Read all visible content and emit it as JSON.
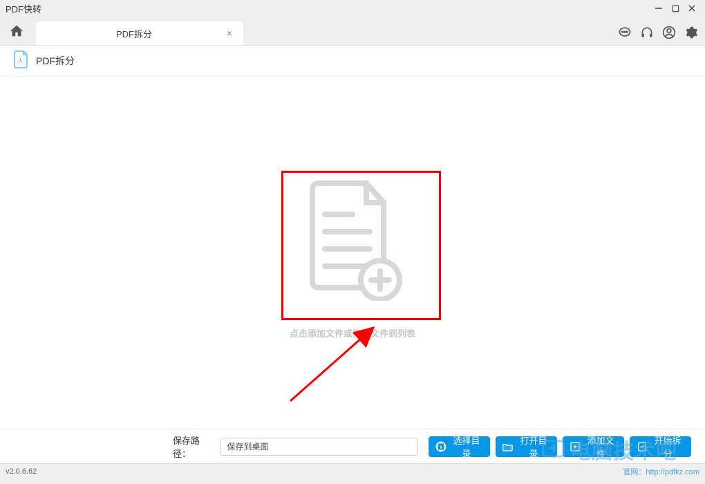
{
  "titlebar": {
    "title": "PDF快转"
  },
  "tab": {
    "label": "PDF拆分"
  },
  "content_header": {
    "label": "PDF拆分"
  },
  "drop": {
    "hint": "点击添加文件或拖拽文件到列表"
  },
  "footer": {
    "save_label": "保存路径：",
    "save_value": "保存到桌面",
    "select_dir": "选择目录",
    "open_dir": "打开目录",
    "add_file": "添加文件",
    "start_split": "开始拆分"
  },
  "statusbar": {
    "version": "v2.0.6.62",
    "website_label": "官网：",
    "website_url": "http://pdfkz.com"
  },
  "watermark": {
    "text": "电脑技术吧"
  }
}
